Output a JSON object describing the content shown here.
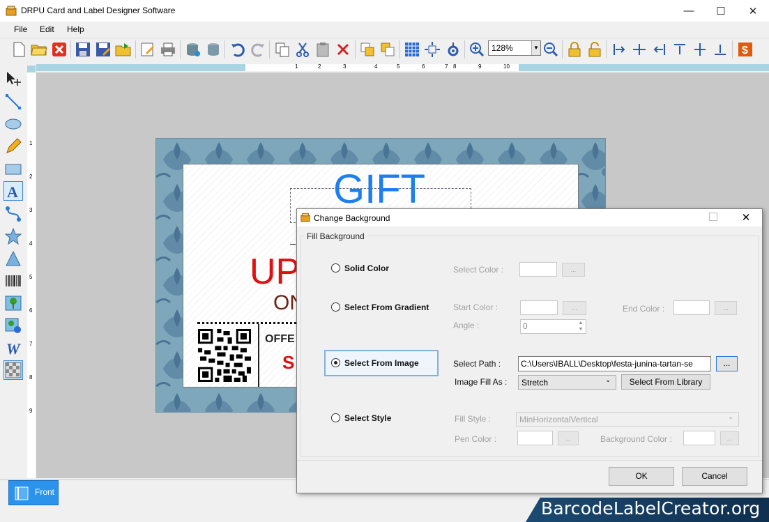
{
  "window": {
    "title": "DRPU Card and Label Designer Software",
    "minimize": "—",
    "maximize": "☐",
    "close": "✕"
  },
  "menu": {
    "file": "File",
    "edit": "Edit",
    "help": "Help"
  },
  "toolbar": {
    "zoom_value": "128%"
  },
  "ruler": {
    "marks": [
      "1",
      "2",
      "3",
      "4",
      "5",
      "6",
      "7",
      "8",
      "9",
      "10"
    ]
  },
  "vruler": {
    "marks": [
      "1",
      "2",
      "3",
      "4",
      "5",
      "6",
      "7",
      "8",
      "9"
    ]
  },
  "card": {
    "gift": "GIFT",
    "upto": "UP",
    "on": "ON",
    "offer": "OFFE",
    "s": "S"
  },
  "tabs": {
    "front": "Front"
  },
  "watermark": "BarcodeLabelCreator.org",
  "dialog": {
    "title": "Change Background",
    "group_label": "Fill Background",
    "solid": {
      "label": "Solid Color",
      "select_color": "Select Color :",
      "btn": "..."
    },
    "gradient": {
      "label": "Select From Gradient",
      "start": "Start Color :",
      "end": "End Color :",
      "angle": "Angle :",
      "angle_value": "0",
      "btn": "..."
    },
    "image": {
      "label": "Select From Image",
      "path_label": "Select Path :",
      "path_value": "C:\\Users\\IBALL\\Desktop\\festa-junina-tartan-se",
      "browse": "...",
      "fill_as_label": "Image Fill As :",
      "fill_as_value": "Stretch",
      "library": "Select From Library"
    },
    "style": {
      "label": "Select Style",
      "fill_style_label": "Fill Style :",
      "fill_style_value": "MinHorizontalVertical",
      "pen_color": "Pen Color :",
      "bg_color": "Background Color :",
      "btn": "..."
    },
    "ok": "OK",
    "cancel": "Cancel"
  }
}
